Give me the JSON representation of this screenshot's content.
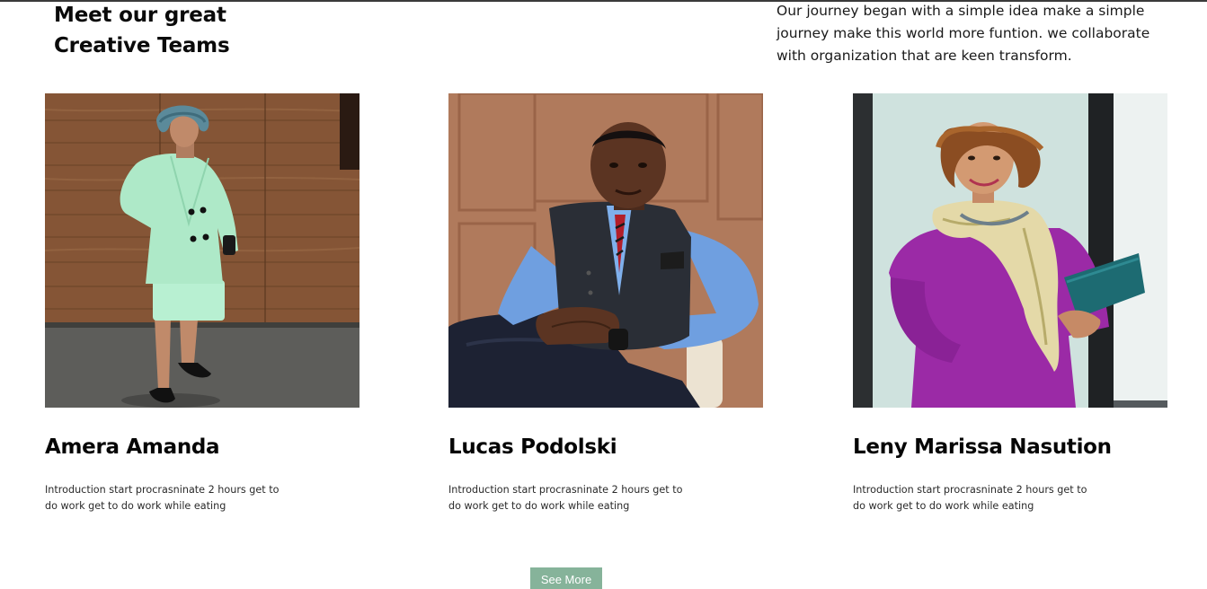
{
  "section": {
    "heading_line1": "Meet our great",
    "heading_line2": "Creative Teams",
    "intro": "Our journey began with a simple idea make a simple journey make this world more funtion. we collaborate with organization that are keen transform."
  },
  "team": [
    {
      "name": "Amera Amanda",
      "description": "Introduction start procrasninate 2 hours get to do work get to do work while eating"
    },
    {
      "name": "Lucas Podolski",
      "description": "Introduction start procrasninate 2 hours get to do work get to do work while eating"
    },
    {
      "name": "Leny Marissa Nasution",
      "description": "Introduction start procrasninate 2 hours get to do work get to do work while eating"
    }
  ],
  "see_more_label": "See More",
  "colors": {
    "button_bg": "#86b39a",
    "button_text": "#ffffff",
    "heading_text": "#0a0a0a"
  }
}
